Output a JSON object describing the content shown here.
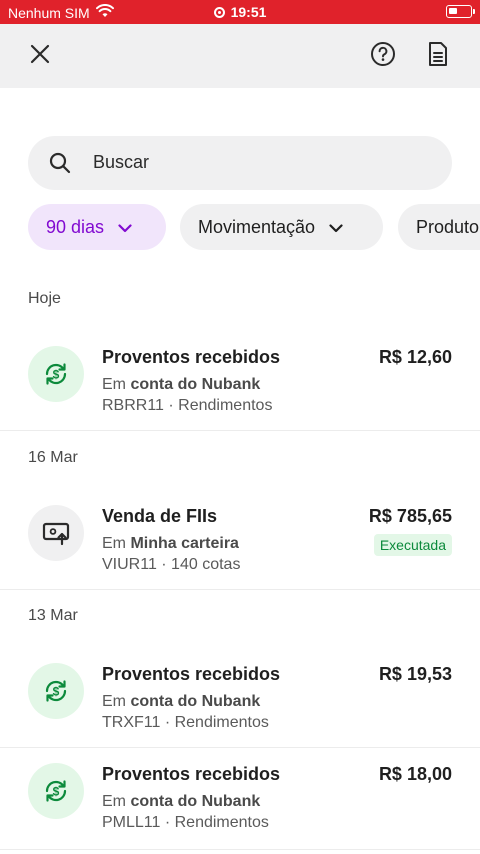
{
  "status_bar": {
    "carrier": "Nenhum SIM",
    "time": "19:51",
    "wifi_icon": "wifi-icon",
    "battery_icon": "battery-icon"
  },
  "top_bar": {
    "close_icon": "close-icon",
    "help_icon": "help-circle-icon",
    "document_icon": "document-icon"
  },
  "search": {
    "placeholder": "Buscar",
    "icon": "search-icon"
  },
  "filters": [
    {
      "label": "90 dias",
      "active": true
    },
    {
      "label": "Movimentação",
      "active": false
    },
    {
      "label": "Produto",
      "active": false
    }
  ],
  "groups": [
    {
      "date": "Hoje",
      "items": [
        {
          "icon": "dollar-cycle-icon",
          "title": "Proventos recebidos",
          "account_prefix": "Em",
          "account": "conta do Nubank",
          "detail": "RBRR11 · Rendimentos",
          "amount": "R$ 12,60"
        }
      ]
    },
    {
      "date": "16 Mar",
      "items": [
        {
          "icon": "sell-screen-icon",
          "title": "Venda de FIIs",
          "account_prefix": "Em",
          "account": "Minha carteira",
          "detail": "VIUR11 · 140 cotas",
          "amount": "R$ 785,65",
          "status": "Executada"
        }
      ]
    },
    {
      "date": "13 Mar",
      "items": [
        {
          "icon": "dollar-cycle-icon",
          "title": "Proventos recebidos",
          "account_prefix": "Em",
          "account": "conta do Nubank",
          "detail": "TRXF11 · Rendimentos",
          "amount": "R$ 19,53"
        },
        {
          "icon": "dollar-cycle-icon",
          "title": "Proventos recebidos",
          "account_prefix": "Em",
          "account": "conta do Nubank",
          "detail": "PMLL11 · Rendimentos",
          "amount": "R$ 18,00"
        }
      ]
    }
  ],
  "colors": {
    "status_bar": "#e0222b",
    "accent_purple": "#820ad1",
    "success_green": "#0d8a3c"
  }
}
